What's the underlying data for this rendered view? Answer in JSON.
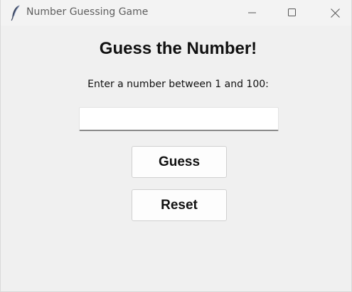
{
  "window": {
    "title": "Number Guessing Game",
    "controls": {
      "minimize_icon": "minimize-icon",
      "maximize_icon": "maximize-icon",
      "close_icon": "close-icon"
    },
    "app_icon": "feather-icon"
  },
  "main": {
    "heading": "Guess the Number!",
    "prompt": "Enter a number between 1 and 100:",
    "guess_input": {
      "value": "",
      "placeholder": ""
    },
    "buttons": {
      "guess_label": "Guess",
      "reset_label": "Reset"
    }
  },
  "colors": {
    "background": "#f0f0f0",
    "titlebar": "#f3f3f3",
    "button_face": "#fdfdfd",
    "text": "#111111"
  }
}
